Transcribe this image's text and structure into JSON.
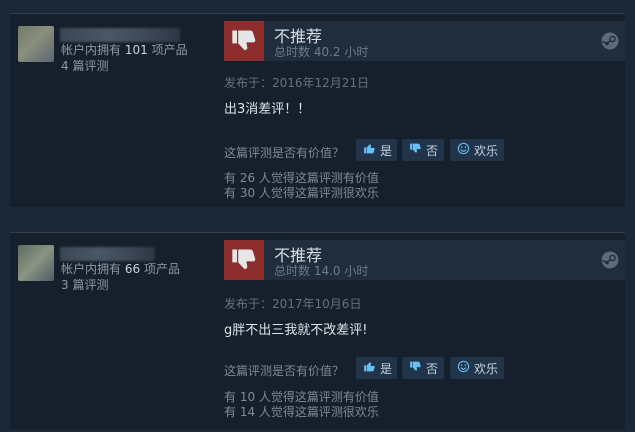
{
  "reviews": [
    {
      "products_prefix": "帐户内拥有",
      "products_count": "101",
      "products_suffix": "项产品",
      "review_count": "4 篇评测",
      "verdict": "不推荐",
      "hours": "总时数 40.2 小时",
      "posted": "发布于：2016年12月21日",
      "content": "出3消差评！！",
      "helpful_question": "这篇评测是否有价值？",
      "btn_yes": "是",
      "btn_no": "否",
      "btn_funny": "欢乐",
      "helpful_stat": "有 26 人觉得这篇评测有价值",
      "funny_stat": "有 30 人觉得这篇评测很欢乐"
    },
    {
      "products_prefix": "帐户内拥有",
      "products_count": "66",
      "products_suffix": "项产品",
      "review_count": "3 篇评测",
      "verdict": "不推荐",
      "hours": "总时数 14.0 小时",
      "posted": "发布于：2017年10月6日",
      "content": "g胖不出三我就不改差评!",
      "helpful_question": "这篇评测是否有价值？",
      "btn_yes": "是",
      "btn_no": "否",
      "btn_funny": "欢乐",
      "helpful_stat": "有 10 人觉得这篇评测有价值",
      "funny_stat": "有 14 人觉得这篇评测很欢乐"
    }
  ],
  "icons": {
    "thumbs_down": "thumbs-down-icon",
    "thumbs_up": "thumbs-up-icon",
    "smile": "smile-icon",
    "steam": "steam-icon"
  },
  "colors": {
    "background": "#1b2838",
    "card": "#16202d",
    "vote_bar": "#1f2d3c",
    "not_recommended": "#8d2e2e",
    "button": "#22344a"
  }
}
